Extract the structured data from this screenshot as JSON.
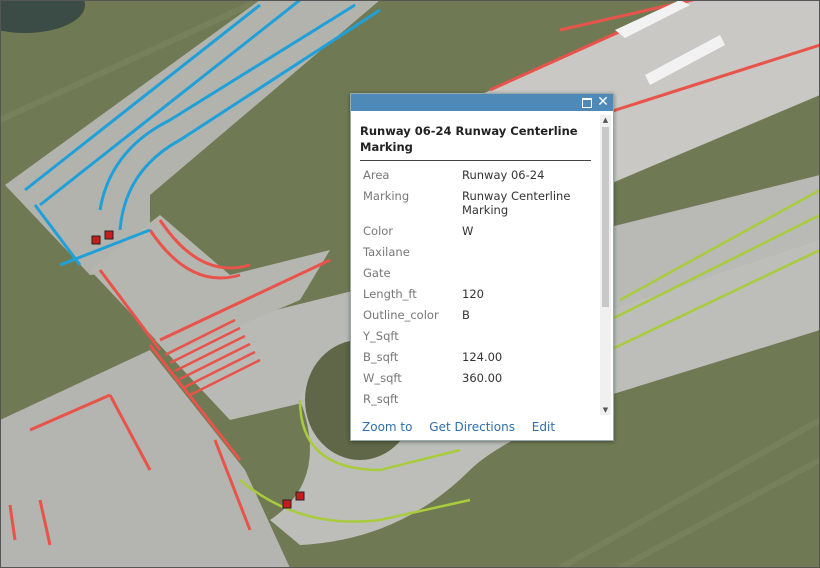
{
  "popup": {
    "title": "Runway 06-24 Runway Centerline Marking",
    "attributes": [
      {
        "label": "Area",
        "value": "Runway 06-24"
      },
      {
        "label": "Marking",
        "value": "Runway Centerline Marking"
      },
      {
        "label": "Color",
        "value": "W"
      },
      {
        "label": "Taxilane",
        "value": ""
      },
      {
        "label": "Gate",
        "value": ""
      },
      {
        "label": "Length_ft",
        "value": "120"
      },
      {
        "label": "Outline_color",
        "value": "B"
      },
      {
        "label": "Y_Sqft",
        "value": ""
      },
      {
        "label": "B_sqft",
        "value": "124.00"
      },
      {
        "label": "W_sqft",
        "value": "360.00"
      },
      {
        "label": "R_sqft",
        "value": ""
      }
    ],
    "actions": {
      "zoom": "Zoom to",
      "directions": "Get Directions",
      "edit": "Edit"
    }
  },
  "icons": {
    "maximize": "maximize-icon",
    "close": "close-icon",
    "close_glyph": "✕"
  },
  "colors": {
    "titlebar": "#4f89b8",
    "link": "#2f6ea8",
    "marking_red": "#e8534a",
    "marking_blue": "#1fa0d8",
    "marking_green": "#a8cc3c",
    "pavement": "#b9b9b6",
    "grass": "#6f7a54"
  }
}
